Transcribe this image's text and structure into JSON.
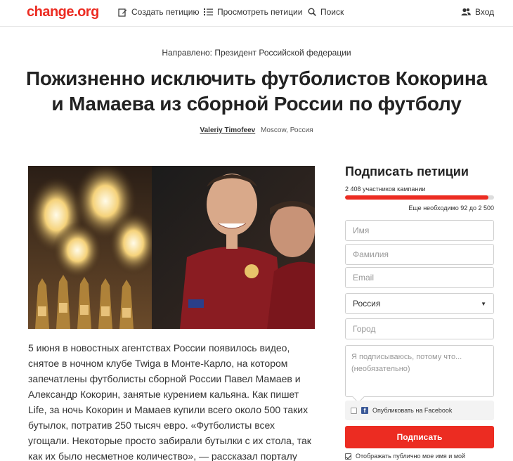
{
  "header": {
    "logo": "change.org",
    "nav": {
      "create": "Создать петицию",
      "browse": "Просмотреть петиции",
      "search": "Поиск",
      "login": "Вход"
    }
  },
  "petition": {
    "directed_to": "Направлено: Президент Российской федерации",
    "title": "Пожизненно исключить футболистов Кокорина и Мамаева из сборной России по футболу",
    "author_name": "Valeriy Timofeev",
    "author_location": "Moscow, Россия",
    "body": "5 июня в новостных агентствах России появилось видео, снятое в ночном клубе Twiga в Монте-Карло, на котором запечатлены футболисты сборной России Павел Мамаев и Александр Кокорин, занятые курением кальяна. Как пишет Life, за ночь Кокорин и Мамаев купили всего около 500 таких бутылок, потратив 250 тысяч евро. «Футболисты всех угощали. Некоторые просто забирали бутылки с их стола, так как их было несметное количество», — рассказал порталу"
  },
  "sign_form": {
    "title": "Подписать петиции",
    "supporters": "2 408 участников кампании",
    "progress_fraction": 0.963,
    "remaining": "Еще необходимо 92 до 2 500",
    "first_name_placeholder": "Имя",
    "last_name_placeholder": "Фамилия",
    "email_placeholder": "Email",
    "country_value": "Россия",
    "city_placeholder": "Город",
    "reason_placeholder": "Я подписываюсь, потому что... (необязательно)",
    "facebook_label": "Опубликовать на Facebook",
    "submit_label": "Подписать",
    "public_label": "Отображать публично мое имя и мой"
  },
  "colors": {
    "brand": "#ec2c22",
    "facebook": "#3b5998"
  }
}
